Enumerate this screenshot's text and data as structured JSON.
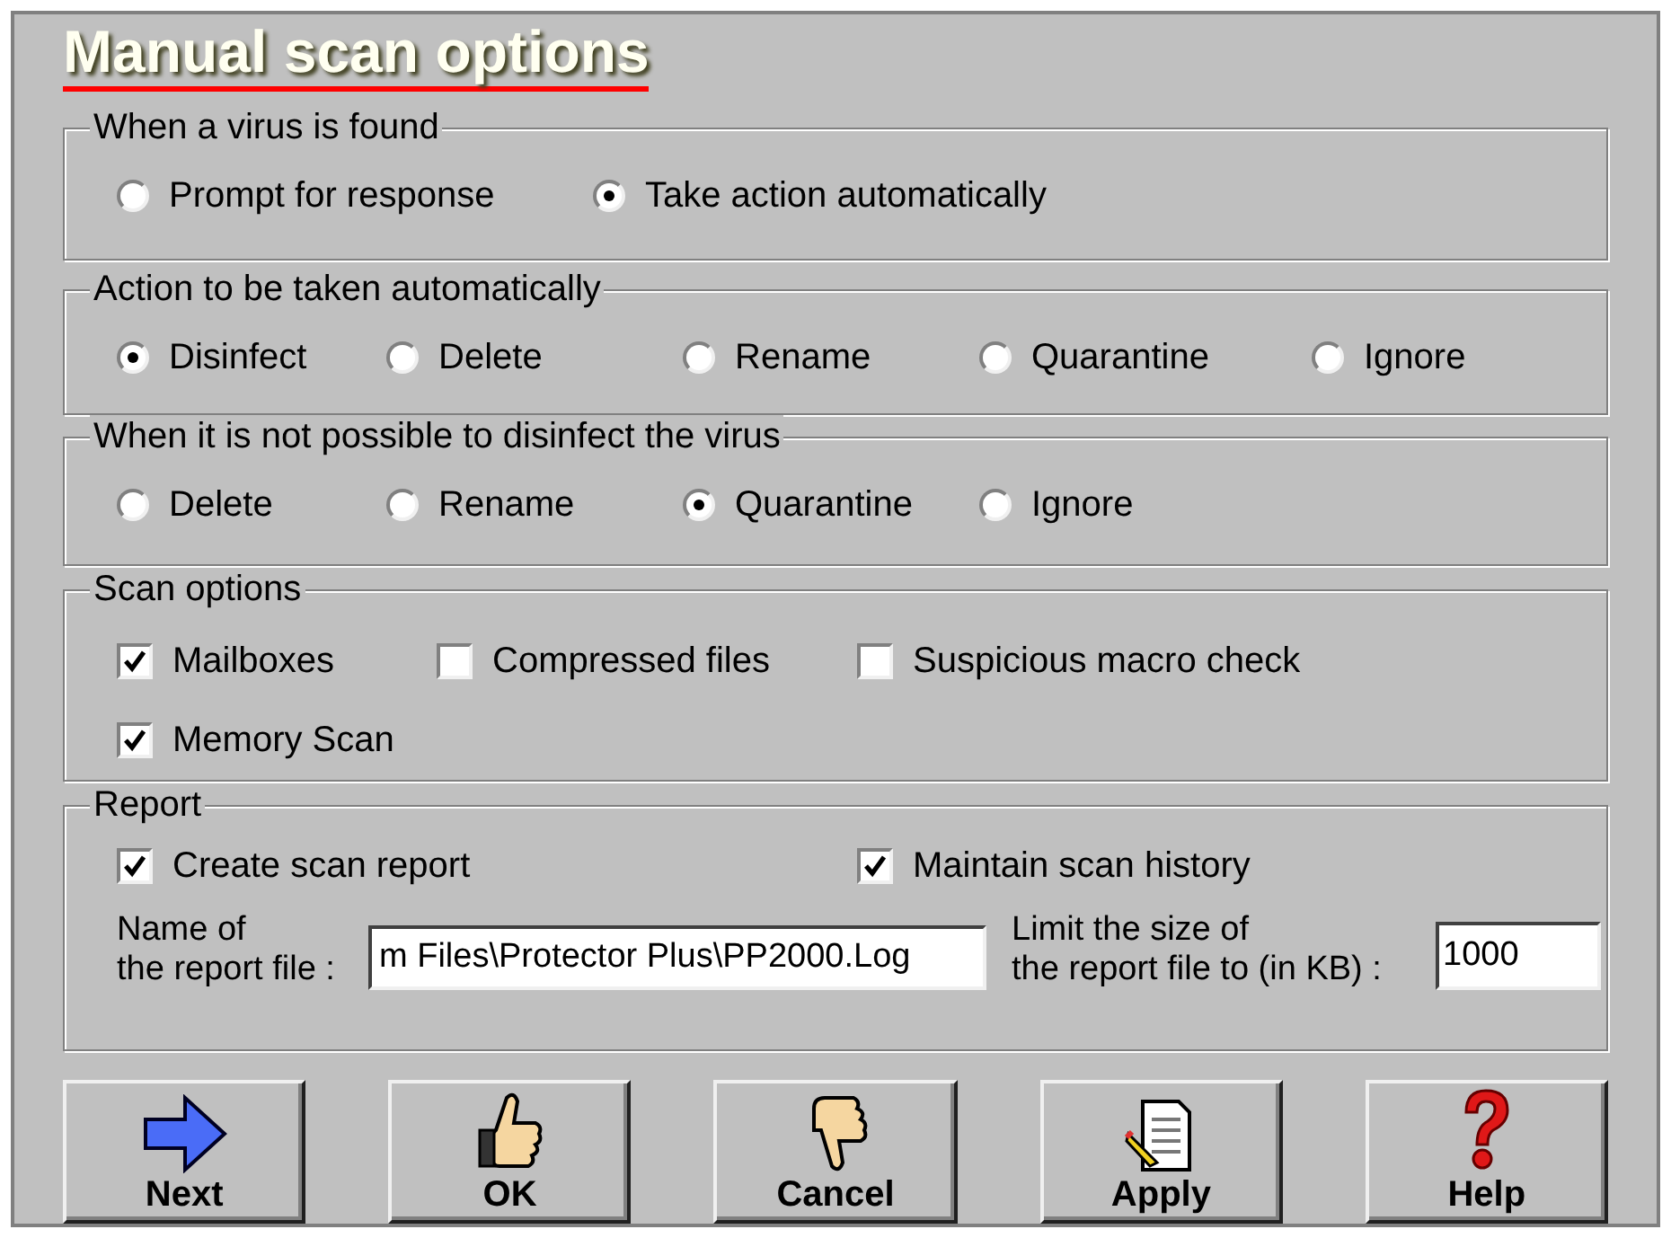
{
  "title": "Manual scan options",
  "groups": [
    {
      "kind": "radio",
      "legend": "When a virus is found",
      "options": [
        {
          "label": "Prompt for response",
          "selected": false
        },
        {
          "label": "Take action automatically",
          "selected": true
        }
      ]
    },
    {
      "kind": "radio",
      "legend": "Action to be taken automatically",
      "options": [
        {
          "label": "Disinfect",
          "selected": true
        },
        {
          "label": "Delete",
          "selected": false
        },
        {
          "label": "Rename",
          "selected": false
        },
        {
          "label": "Quarantine",
          "selected": false
        },
        {
          "label": "Ignore",
          "selected": false
        }
      ]
    },
    {
      "kind": "radio",
      "legend": "When it is not possible to disinfect the virus",
      "options": [
        {
          "label": "Delete",
          "selected": false
        },
        {
          "label": "Rename",
          "selected": false
        },
        {
          "label": "Quarantine",
          "selected": true
        },
        {
          "label": "Ignore",
          "selected": false
        }
      ]
    },
    {
      "kind": "checkbox",
      "legend": "Scan options",
      "options": [
        {
          "label": "Mailboxes",
          "checked": true
        },
        {
          "label": "Compressed files",
          "checked": false
        },
        {
          "label": "Suspicious macro check",
          "checked": false
        },
        {
          "label": "Memory Scan",
          "checked": true
        }
      ]
    }
  ],
  "report": {
    "legend": "Report",
    "options": [
      {
        "label": "Create scan report",
        "checked": true
      },
      {
        "label": "Maintain scan history",
        "checked": true
      }
    ],
    "file_label": "Name of\nthe report file :",
    "file_value": "m Files\\Protector Plus\\PP2000.Log",
    "limit_label": "Limit the size of\nthe report file to (in KB) :",
    "limit_value": "1000"
  },
  "buttons": [
    {
      "kind": "next",
      "label": "Next"
    },
    {
      "kind": "ok",
      "label": "OK"
    },
    {
      "kind": "cancel",
      "label": "Cancel"
    },
    {
      "kind": "apply",
      "label": "Apply"
    },
    {
      "kind": "help",
      "label": "Help"
    }
  ]
}
